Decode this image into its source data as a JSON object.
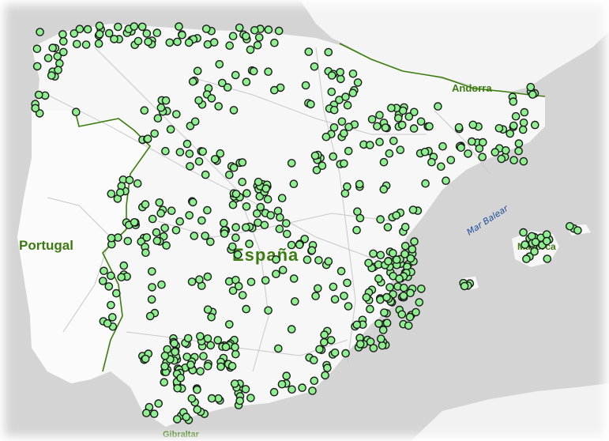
{
  "map": {
    "labels": {
      "spain": "España",
      "portugal": "Portugal",
      "andorra": "Andorra",
      "sea": "Mar Balear",
      "mallorca": "Mallorca",
      "gibraltar": "Gibraltar"
    },
    "colors": {
      "sea": "#d2d2d2",
      "land": "#f7f7f7",
      "border": "#3a7d0c",
      "marker_fill": "#8ff08f",
      "marker_stroke": "#1a1a1a",
      "label_country": "#3c7a12",
      "label_sea": "#1f4e9c"
    },
    "marker_icon": "green-circle-marker-icon"
  }
}
